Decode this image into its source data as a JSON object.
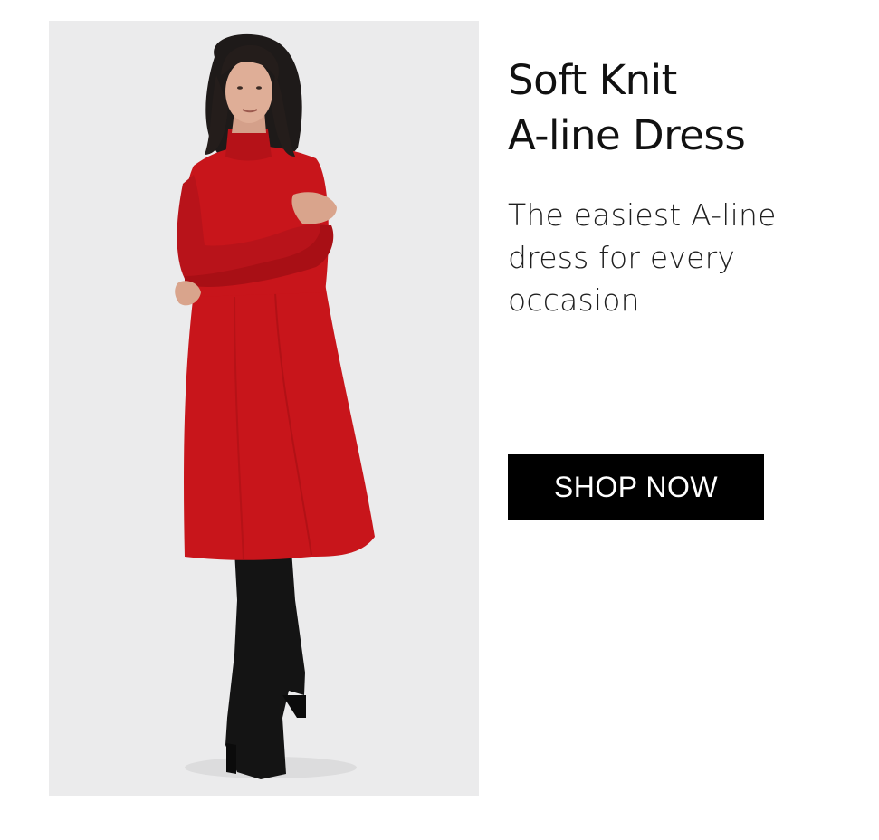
{
  "promo": {
    "title_lines": [
      "Soft Knit",
      "A-line Dress"
    ],
    "subtitle_lines": [
      "The easiest A-line",
      "dress for every",
      "occasion"
    ],
    "cta_label": "SHOP NOW"
  },
  "colors": {
    "photo_background": "#ebebec",
    "dress": "#c8151b",
    "button_background": "#000000",
    "button_text": "#ffffff",
    "title_text": "#111111"
  }
}
